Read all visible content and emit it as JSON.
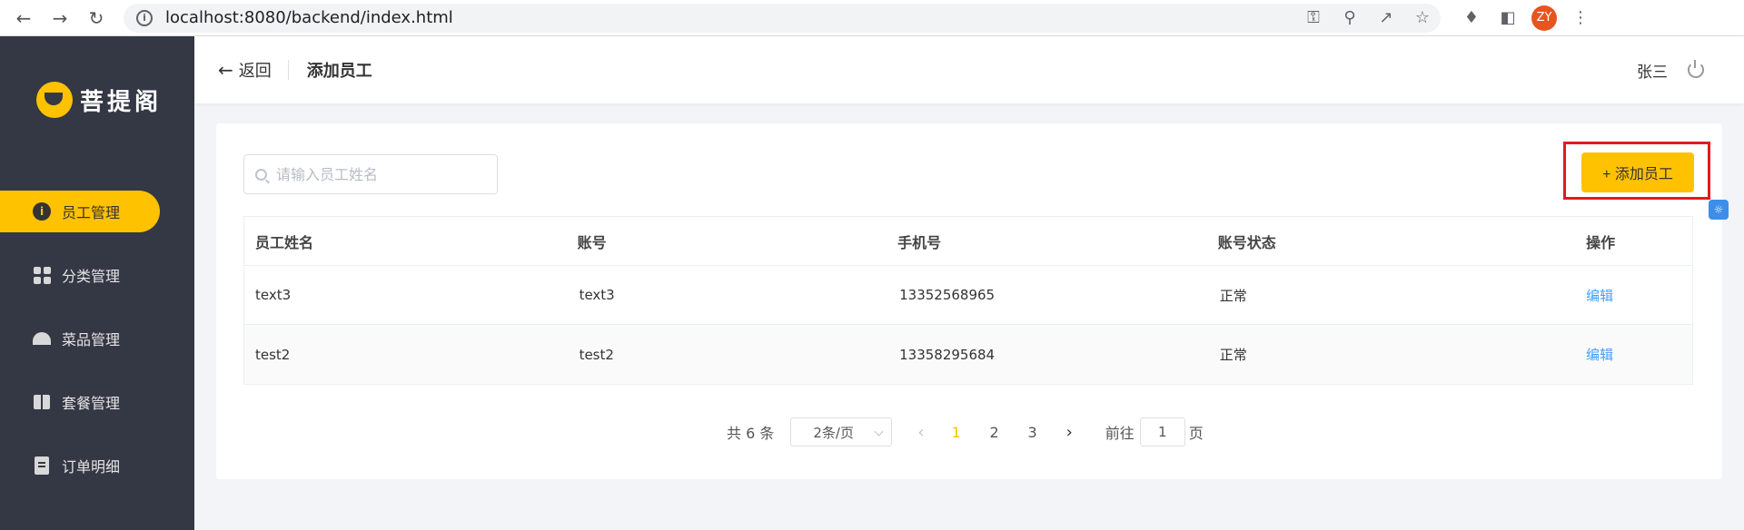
{
  "browser": {
    "url": "localhost:8080/backend/index.html",
    "profile_initials": "ZY",
    "icons": [
      "back-arrow-icon",
      "forward-arrow-icon",
      "reload-icon",
      "site-info-icon",
      "key-icon",
      "zoom-icon",
      "share-icon",
      "star-icon",
      "extensions-icon",
      "sidebar-panel-icon",
      "menu-dots-icon"
    ]
  },
  "sidebar": {
    "logo_text": "菩提阁",
    "items": [
      {
        "label": "员工管理",
        "icon": "employee-icon",
        "active": true
      },
      {
        "label": "分类管理",
        "icon": "category-grid-icon",
        "active": false
      },
      {
        "label": "菜品管理",
        "icon": "dish-cloche-icon",
        "active": false
      },
      {
        "label": "套餐管理",
        "icon": "gift-icon",
        "active": false
      },
      {
        "label": "订单明细",
        "icon": "clipboard-icon",
        "active": false
      }
    ]
  },
  "header": {
    "back_label": "返回",
    "title": "添加员工",
    "user_name": "张三"
  },
  "toolbar": {
    "search_placeholder": "请输入员工姓名",
    "add_button_label": "+ 添加员工"
  },
  "table": {
    "columns": [
      "员工姓名",
      "账号",
      "手机号",
      "账号状态",
      "操作"
    ],
    "rows": [
      {
        "name": "text3",
        "account": "text3",
        "phone": "13352568965",
        "status": "正常",
        "action": "编辑"
      },
      {
        "name": "test2",
        "account": "test2",
        "phone": "13358295684",
        "status": "正常",
        "action": "编辑"
      }
    ]
  },
  "pagination": {
    "total_text": "共 6 条",
    "page_size": "2条/页",
    "pages": [
      "1",
      "2",
      "3"
    ],
    "current_page": "1",
    "goto_label": "前往",
    "goto_value": "1",
    "page_suffix": "页"
  },
  "colors": {
    "accent": "#ffc200",
    "sidebar_bg": "#343744",
    "link": "#419eff",
    "highlight_frame": "#e21b1b"
  }
}
